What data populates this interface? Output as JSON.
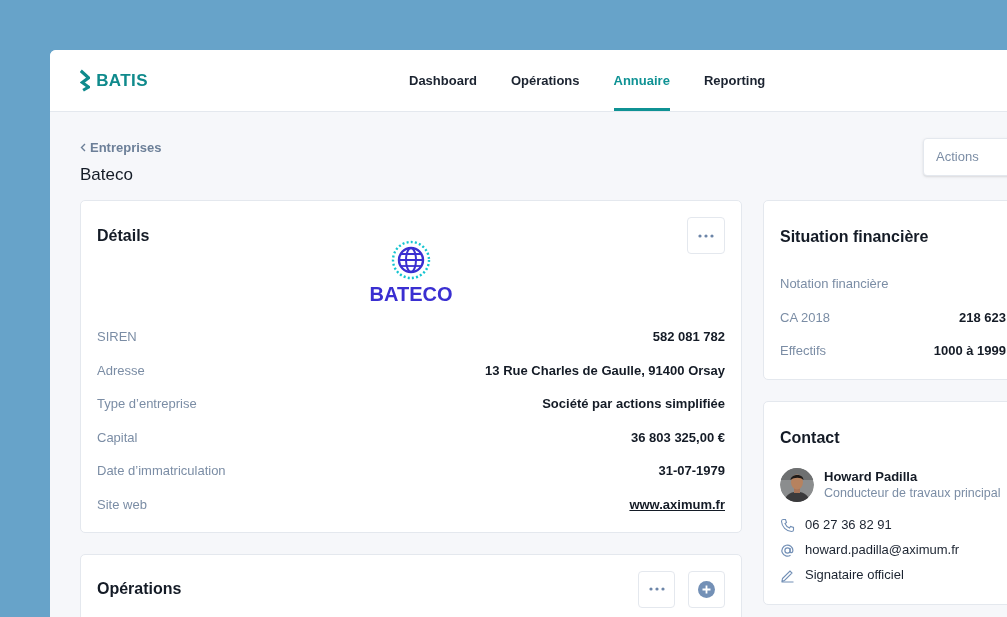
{
  "brand": "BATIS",
  "nav": [
    {
      "label": "Dashboard",
      "selected": false
    },
    {
      "label": "Opérations",
      "selected": false
    },
    {
      "label": "Annuaire",
      "selected": true
    },
    {
      "label": "Reporting",
      "selected": false
    }
  ],
  "breadcrumb": "Entreprises",
  "page_title": "Bateco",
  "actions_button": "Actions",
  "details": {
    "title": "Détails",
    "logo_text": "BATECO",
    "rows": [
      {
        "label": "SIREN",
        "value": "582 081 782",
        "kind": "text"
      },
      {
        "label": "Adresse",
        "value": "13 Rue Charles de Gaulle, 91400 Orsay",
        "kind": "text"
      },
      {
        "label": "Type d’entreprise",
        "value": "Société par actions simplifiée",
        "kind": "text"
      },
      {
        "label": "Capital",
        "value": "36 803 325,00 €",
        "kind": "text"
      },
      {
        "label": "Date d’immatriculation",
        "value": "31-07-1979",
        "kind": "text"
      },
      {
        "label": "Site web",
        "value": "www.aximum.fr",
        "kind": "link"
      }
    ]
  },
  "finance": {
    "title": "Situation financière",
    "rows": [
      {
        "label": "Notation financière"
      },
      {
        "label": "CA 2018",
        "value": "218 623"
      },
      {
        "label": "Effectifs",
        "value": "1000 à 1999"
      }
    ]
  },
  "contact": {
    "title": "Contact",
    "name": "Howard Padilla",
    "role": "Conducteur de travaux principal",
    "lines": [
      {
        "kind": "phone",
        "text": "06 27 36 82 91"
      },
      {
        "kind": "email",
        "text": "howard.padilla@aximum.fr"
      },
      {
        "kind": "signatory",
        "text": "Signataire officiel"
      }
    ]
  },
  "operations": {
    "title": "Opérations"
  }
}
